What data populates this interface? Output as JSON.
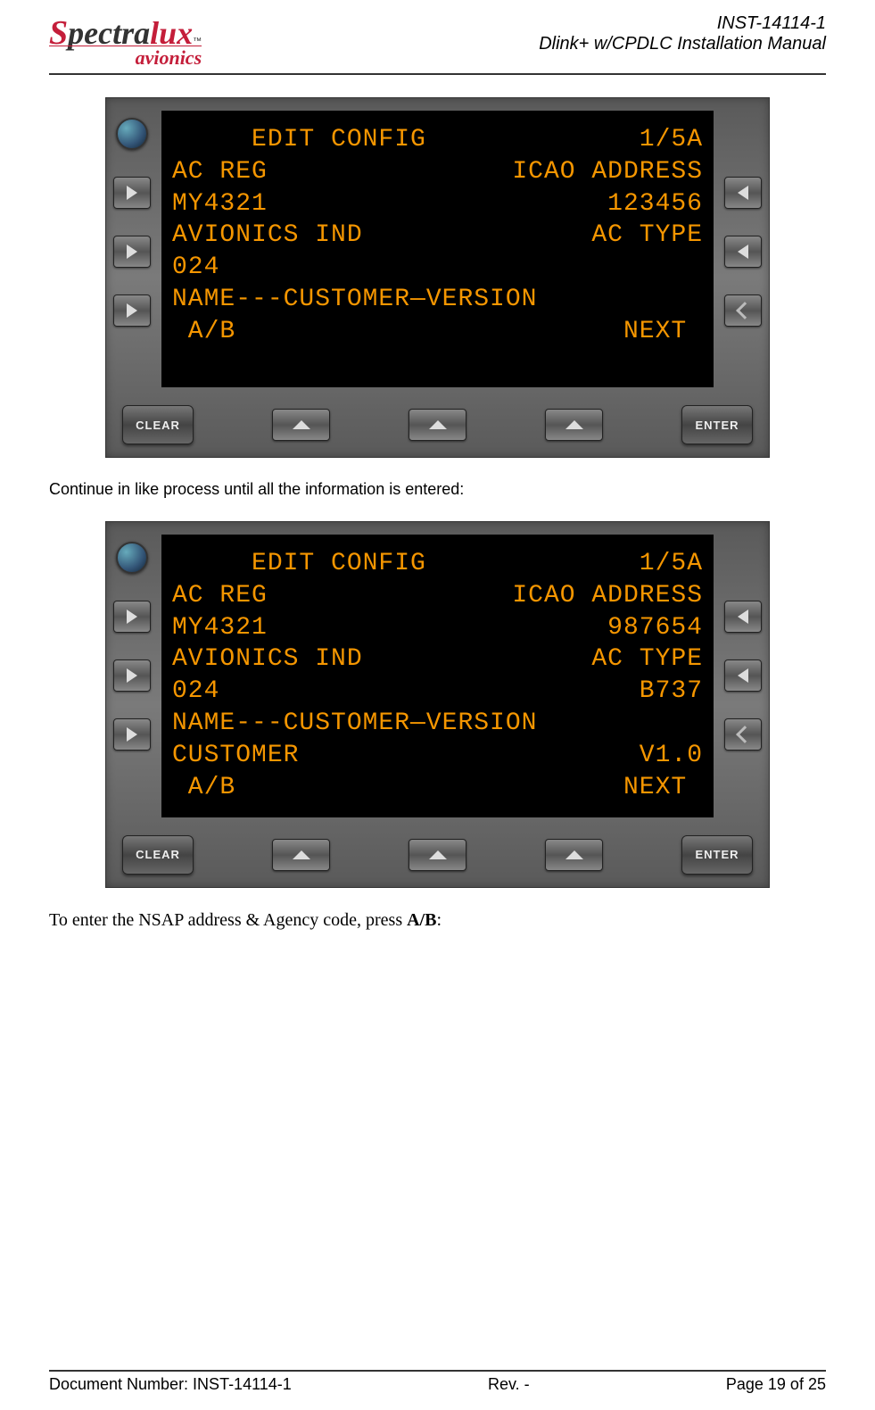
{
  "header": {
    "logo_brand1": "S",
    "logo_brand2": "pectra",
    "logo_brand3": "lux",
    "logo_tm": "™",
    "logo_sub": "avionics",
    "doc_id": "INST-14114-1",
    "doc_title": "Dlink+ w/CPDLC Installation Manual"
  },
  "panel1": {
    "screen": {
      "title_left": "     EDIT CONFIG",
      "title_right": "1/5A",
      "l1_left": "AC REG",
      "l1_right": "ICAO ADDRESS",
      "l2_left": "MY4321",
      "l2_right": "123456",
      "l3_left": "AVIONICS IND",
      "l3_right": "AC TYPE",
      "l4_left": "024",
      "l4_right": "",
      "l5": "NAME---CUSTOMER—VERSION",
      "l6": "",
      "l7_left": " A/B",
      "l7_right": "NEXT "
    },
    "buttons": {
      "clear": "CLEAR",
      "enter": "ENTER"
    }
  },
  "text1": "Continue in like process until all the information is entered:",
  "panel2": {
    "screen": {
      "title_left": "     EDIT CONFIG",
      "title_right": "1/5A",
      "l1_left": "AC REG",
      "l1_right": "ICAO ADDRESS",
      "l2_left": "MY4321",
      "l2_right": "987654",
      "l3_left": "AVIONICS IND",
      "l3_right": "AC TYPE",
      "l4_left": "024",
      "l4_right": "B737",
      "l5": "NAME---CUSTOMER—VERSION",
      "l6_left": "CUSTOMER",
      "l6_right": "V1.0",
      "l7_left": " A/B",
      "l7_right": "NEXT "
    },
    "buttons": {
      "clear": "CLEAR",
      "enter": "ENTER"
    }
  },
  "text2_pre": "To enter the NSAP address & Agency code, press ",
  "text2_bold": "A/B",
  "text2_post": ":",
  "footer": {
    "left": "Document Number:  INST-14114-1",
    "center": "Rev. -",
    "right": "Page 19 of 25"
  }
}
